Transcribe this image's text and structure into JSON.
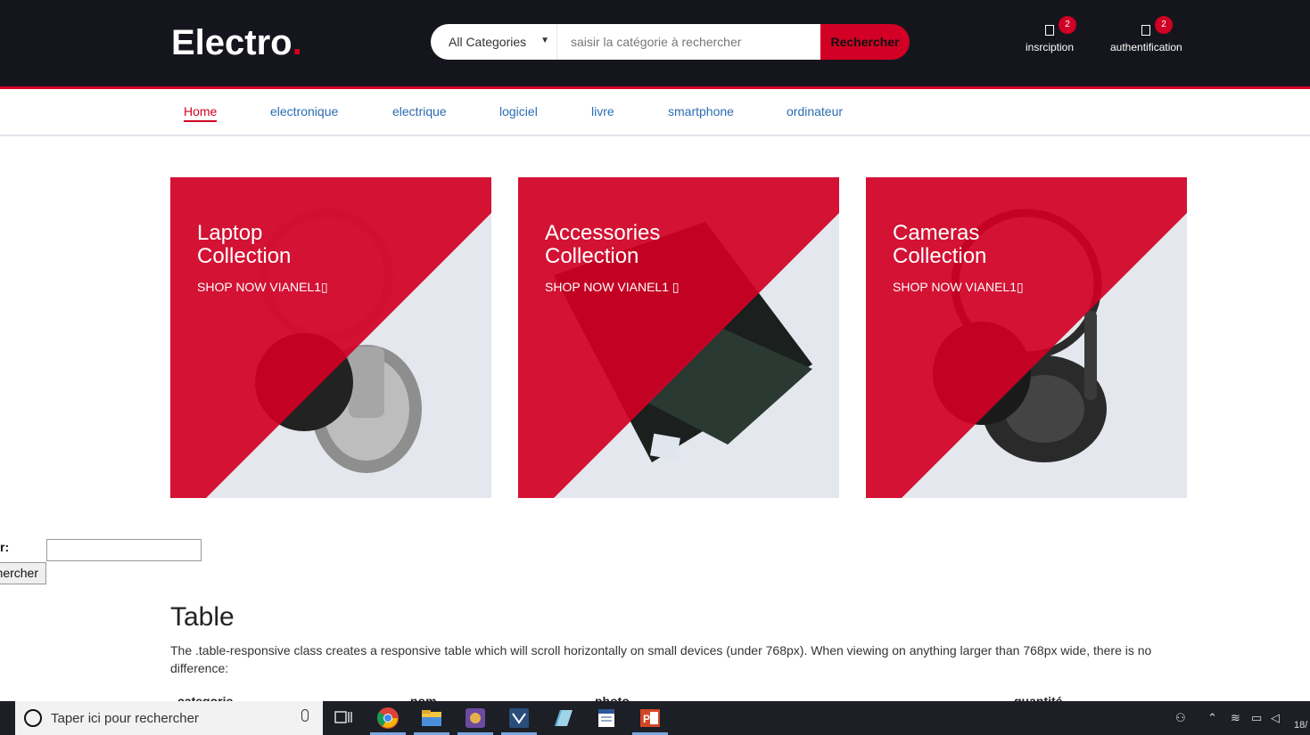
{
  "header": {
    "logo": "Electro",
    "logo_dot": ".",
    "search": {
      "category": "All Categories",
      "placeholder": "saisir la catégorie à rechercher",
      "button": "Rechercher"
    },
    "actions": [
      {
        "label": "insrciption",
        "badge": "2"
      },
      {
        "label": "authentification",
        "badge": "2"
      }
    ]
  },
  "nav": {
    "items": [
      "Home",
      "electronique",
      "electrique",
      "logiciel",
      "livre",
      "smartphone",
      "ordinateur"
    ]
  },
  "cards": [
    {
      "title_line1": "Laptop",
      "title_line2": "Collection",
      "cta": "SHOP NOW VIANEL1▯",
      "image": "headphones-silver"
    },
    {
      "title_line1": "Accessories",
      "title_line2": "Collection",
      "cta": "SHOP NOW VIANEL1 ▯",
      "image": "laptop-black"
    },
    {
      "title_line1": "Cameras",
      "title_line2": "Collection",
      "cta": "SHOP NOW VIANEL1▯",
      "image": "headphones-black"
    }
  ],
  "form": {
    "label": "r:",
    "button": "hercher"
  },
  "table_section": {
    "title": "Table",
    "description": "The .table-responsive class creates a responsive table which will scroll horizontally on small devices (under 768px). When viewing on anything larger than 768px wide, there is no difference:",
    "headers": [
      "categorie",
      "nom",
      "photo",
      "quantité"
    ]
  },
  "taskbar": {
    "search_text": "Taper ici pour rechercher",
    "apps": [
      "chrome-icon",
      "file-explorer-icon",
      "app-icon",
      "visual-studio-icon",
      "notepad-icon",
      "word-icon",
      "powerpoint-icon"
    ],
    "clock_fragment": "18/"
  },
  "colors": {
    "header_bg": "#15161d",
    "accent": "#d10024",
    "nav_link": "#2b6cb0"
  }
}
